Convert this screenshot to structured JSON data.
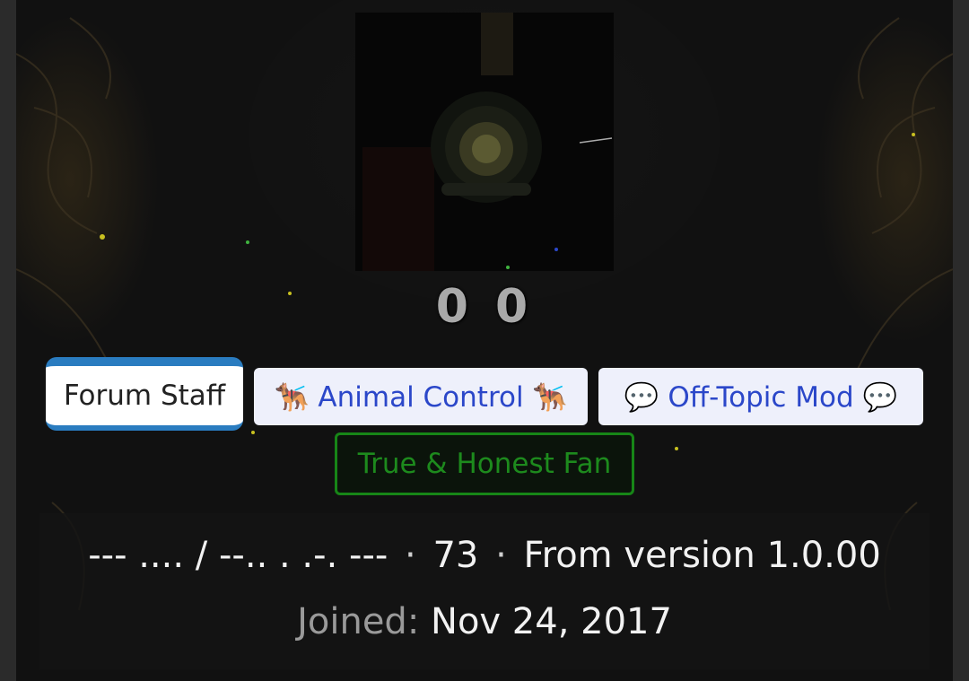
{
  "profile": {
    "username": "0 0",
    "avatar_alt": "",
    "badges": {
      "forum_staff": "Forum Staff",
      "animal_control": "🐕‍🦺 Animal Control 🐕‍🦺",
      "off_topic_mod": "💬 Off-Topic Mod 💬",
      "true_honest_fan": "True & Honest Fan"
    },
    "info": {
      "title": "--- .... / --.. . .-. ---",
      "separator": "·",
      "reactions": "73",
      "from_version": "From version 1.0.00",
      "joined_label": "Joined:",
      "joined_date": "Nov 24, 2017"
    }
  },
  "colors": {
    "staff_accent": "#2a7cc0",
    "mod_badge_bg": "#eef0fb",
    "mod_badge_text": "#2b47c9",
    "fan_badge": "#178617",
    "username_color": "#a9a9a9"
  }
}
